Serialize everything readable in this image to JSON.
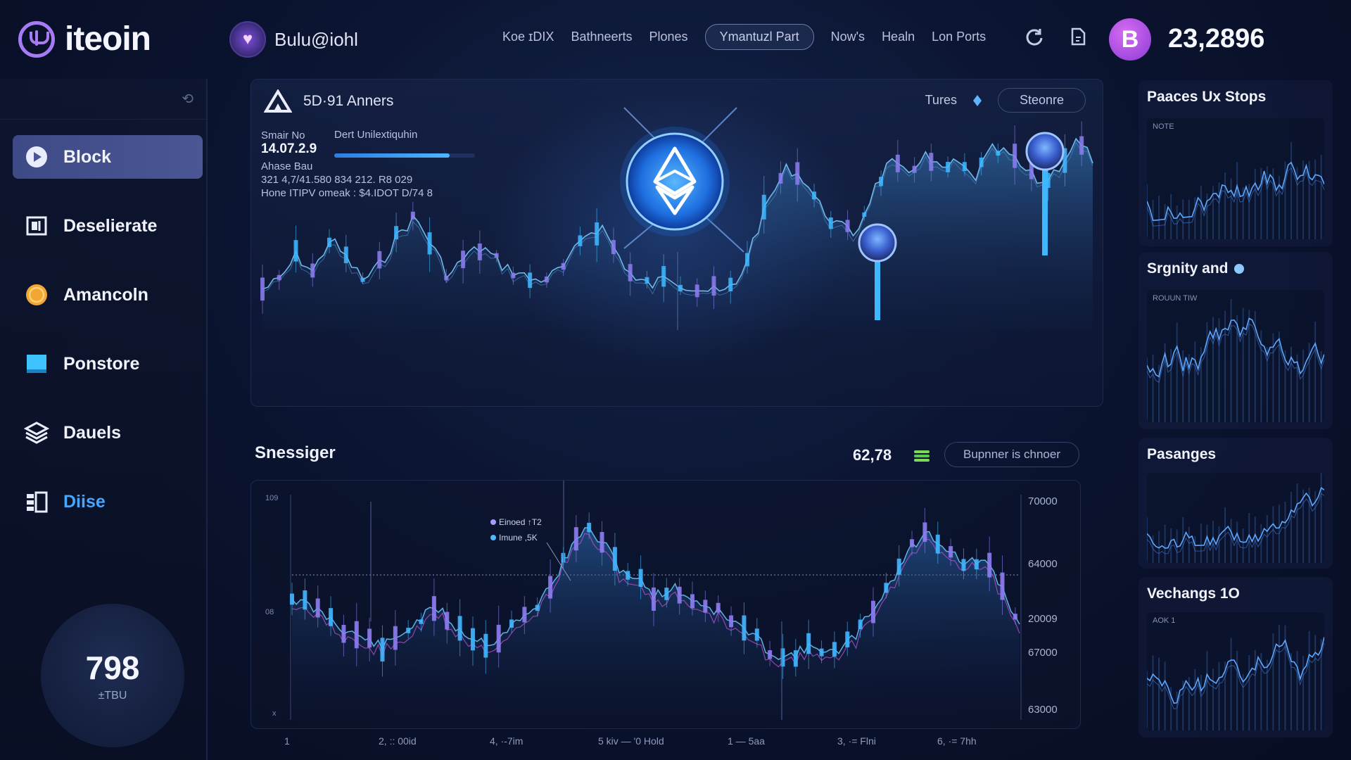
{
  "header": {
    "app_name": "iteoin",
    "user_name": "Bulu@iohl",
    "nav": [
      "Koe ɪDIX",
      "Bathneerts",
      "Plones",
      "Ymantuzl Part",
      "Now's",
      "Healn",
      "Lon Ports"
    ],
    "nav_active_index": 3,
    "balance_badge": "B",
    "balance": "23,2896"
  },
  "sidebar": {
    "items": [
      {
        "label": "Block",
        "icon": "play-icon",
        "active": true
      },
      {
        "label": "Deselierate",
        "icon": "document-icon",
        "active": false
      },
      {
        "label": "Amancoln",
        "icon": "coin-icon",
        "active": false
      },
      {
        "label": "Ponstore",
        "icon": "square-icon",
        "active": false
      },
      {
        "label": "Dauels",
        "icon": "layers-icon",
        "active": false
      },
      {
        "label": "Diise",
        "icon": "list-icon",
        "active": false
      }
    ],
    "gauge": {
      "value": "798",
      "label": "±TBU"
    }
  },
  "main_chart": {
    "title": "5D·91 Anners",
    "tool_label": "Tures",
    "tool_button": "Steonre",
    "stats": {
      "label_1": "Smair No",
      "value_1": "14.07.2.9",
      "label_2": "Dert Unilextiquhin",
      "label_3": "Ahase Bau",
      "line_1": "321 4,7/41.580 834  212. R8 029",
      "line_2": "Hone ITIPV omeak : $4.IDOT D/74 8",
      "progress": 0.82
    },
    "center_icon": "ethereum-icon"
  },
  "lower_chart": {
    "title": "Snessiger",
    "value": "62,78",
    "button": "Bupnner is chnoer",
    "legend": [
      "Einoed ↑T2",
      "Imune ,5K"
    ],
    "y_ticks": [
      "70000",
      "64000",
      "20009",
      "67000",
      "63000"
    ],
    "left_ticks": [
      "109",
      "08",
      "x"
    ],
    "x_ticks": [
      "1",
      "2, :: 00id",
      "4, ·-7im",
      "5 kiv  —  '0 Hold",
      "1 — 5aa",
      "3, ·= Flni",
      "6, ·= 7hh"
    ]
  },
  "right_panels": [
    {
      "title": "Paaces Ux Stops",
      "chart_label": "NOTE"
    },
    {
      "title": "Srgnity and",
      "chart_label": "ROUUN TIW"
    },
    {
      "title": "Pasanges",
      "chart_label": ""
    },
    {
      "title": "Vechangs 1O",
      "chart_label": "AOK 1"
    }
  ],
  "colors": {
    "accent_blue": "#3fa2ff",
    "accent_purple": "#8a6ff0",
    "background": "#0b1430"
  }
}
